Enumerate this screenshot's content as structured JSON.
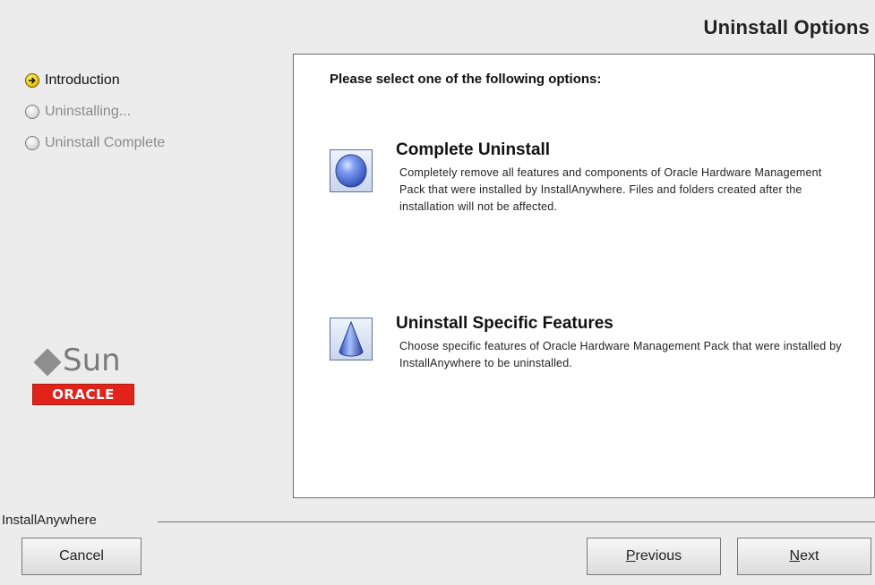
{
  "window": {
    "title": "Uninstall Options"
  },
  "steps": [
    {
      "label": "Introduction",
      "state": "current"
    },
    {
      "label": "Uninstalling...",
      "state": "pending"
    },
    {
      "label": "Uninstall Complete",
      "state": "pending"
    }
  ],
  "logo": {
    "sun": "Sun",
    "oracle": "ORACLE"
  },
  "panel": {
    "prompt": "Please select one of the following options:",
    "options": [
      {
        "title": "Complete Uninstall",
        "description": "Completely remove all features and components of Oracle Hardware Management Pack that were installed by InstallAnywhere. Files and folders created after the installation will not be affected.",
        "icon": "sphere-icon"
      },
      {
        "title": "Uninstall Specific Features",
        "description": "Choose specific features of Oracle Hardware Management Pack that were installed by InstallAnywhere to be uninstalled.",
        "icon": "cone-icon"
      }
    ]
  },
  "footer": {
    "brand": "InstallAnywhere",
    "cancel": "Cancel",
    "previous": {
      "mnemonic": "P",
      "rest": "revious"
    },
    "next": {
      "mnemonic": "N",
      "rest": "ext"
    }
  },
  "colors": {
    "oracle_red": "#e2231a",
    "panel_bg": "#ffffff",
    "window_bg": "#ececec"
  }
}
